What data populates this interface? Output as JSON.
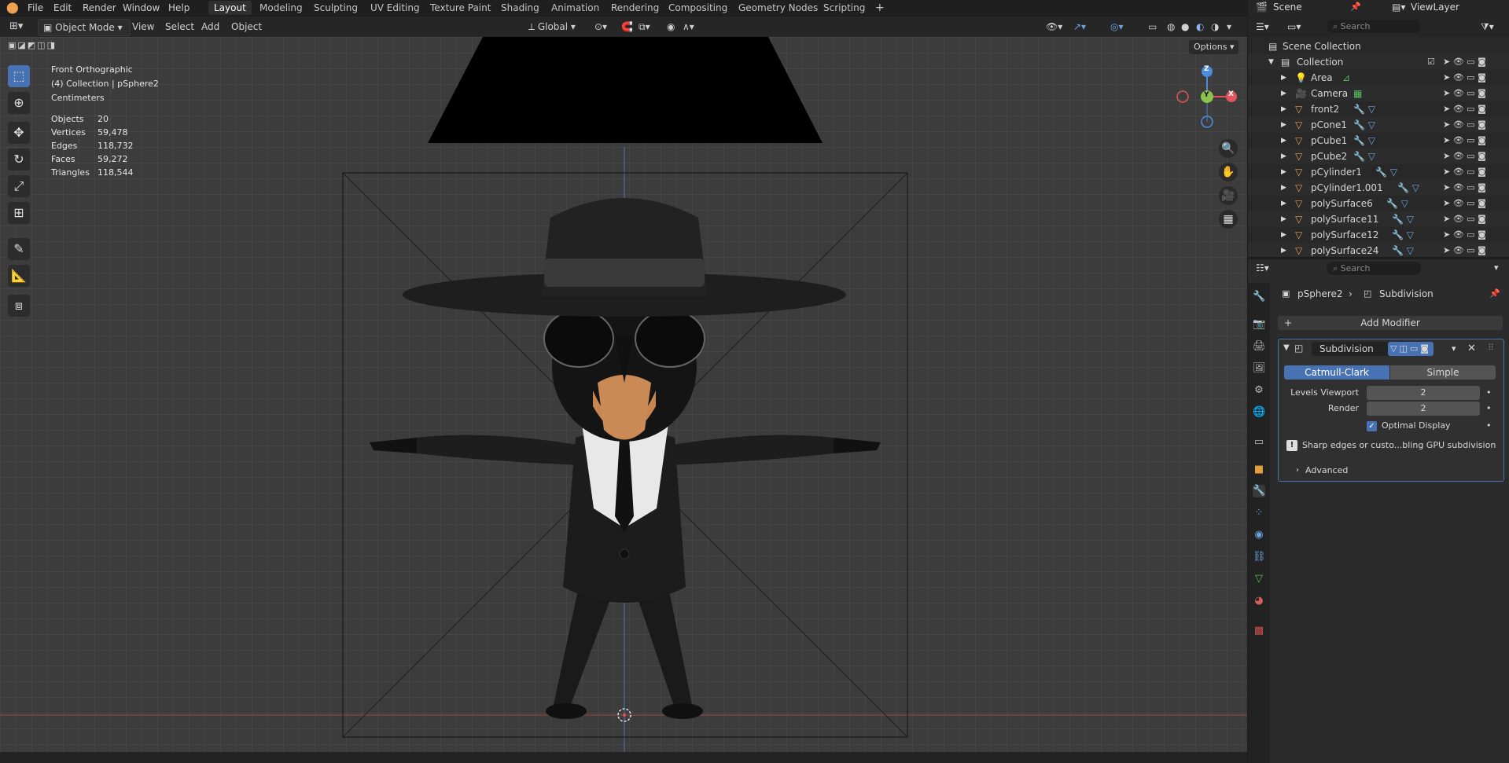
{
  "menu": {
    "items": [
      "File",
      "Edit",
      "Render",
      "Window",
      "Help"
    ]
  },
  "workspaces": [
    "Layout",
    "Modeling",
    "Sculpting",
    "UV Editing",
    "Texture Paint",
    "Shading",
    "Animation",
    "Rendering",
    "Compositing",
    "Geometry Nodes",
    "Scripting"
  ],
  "active_workspace": "Layout",
  "scene": {
    "name": "Scene",
    "view_layer": "ViewLayer"
  },
  "viewport_header": {
    "mode": "Object Mode",
    "menus": [
      "View",
      "Select",
      "Add",
      "Object"
    ],
    "orientation": "Global",
    "options_label": "Options"
  },
  "viewport_info": {
    "view_name": "Front Orthographic",
    "context": "(4) Collection | pSphere2",
    "units": "Centimeters",
    "stats": [
      {
        "label": "Objects",
        "value": "20"
      },
      {
        "label": "Vertices",
        "value": "59,478"
      },
      {
        "label": "Edges",
        "value": "118,732"
      },
      {
        "label": "Faces",
        "value": "59,272"
      },
      {
        "label": "Triangles",
        "value": "118,544"
      }
    ]
  },
  "gizmo": {
    "x": "X",
    "y": "Y",
    "z": "Z"
  },
  "outliner": {
    "search_placeholder": "Search",
    "root": "Scene Collection",
    "collection": "Collection",
    "items": [
      "Area",
      "Camera",
      "front2",
      "pCone1",
      "pCube1",
      "pCube2",
      "pCylinder1",
      "pCylinder1.001",
      "polySurface6",
      "polySurface11",
      "polySurface12",
      "polySurface24"
    ]
  },
  "properties": {
    "search_placeholder": "Search",
    "breadcrumb_object": "pSphere2",
    "breadcrumb_modifier": "Subdivision",
    "add_modifier": "Add Modifier",
    "modifier_name": "Subdivision",
    "algo_catmull": "Catmull-Clark",
    "algo_simple": "Simple",
    "levels_viewport_label": "Levels Viewport",
    "levels_viewport_value": "2",
    "render_label": "Render",
    "render_value": "2",
    "optimal_display": "Optimal Display",
    "info_message": "Sharp edges or custo...bling GPU subdivision",
    "advanced": "Advanced"
  },
  "colors": {
    "accent": "#4772b3",
    "x_axis": "#e0545a",
    "y_axis": "#8bc34a",
    "z_axis": "#4a8cdc"
  }
}
